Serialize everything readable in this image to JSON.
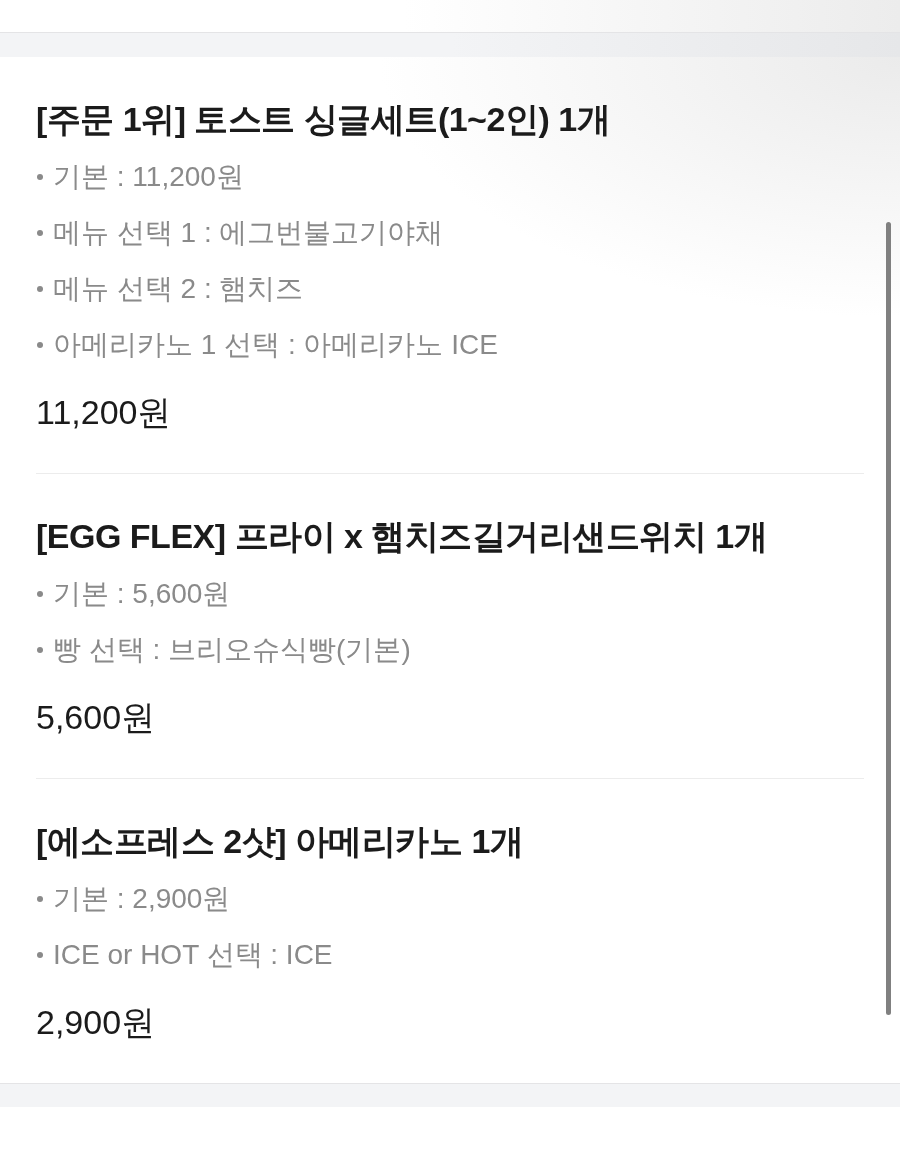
{
  "order_items": [
    {
      "title": "[주문 1위] 토스트 싱글세트(1~2인) 1개",
      "options": [
        "기본 : 11,200원",
        "메뉴 선택 1 : 에그번불고기야채",
        "메뉴 선택 2 : 햄치즈",
        "아메리카노 1 선택 : 아메리카노 ICE"
      ],
      "price": "11,200원"
    },
    {
      "title": "[EGG FLEX] 프라이 x 햄치즈길거리샌드위치 1개",
      "options": [
        "기본 : 5,600원",
        "빵 선택 : 브리오슈식빵(기본)"
      ],
      "price": "5,600원"
    },
    {
      "title": "[에소프레스 2샷] 아메리카노 1개",
      "options": [
        "기본 : 2,900원",
        "ICE or HOT 선택 : ICE"
      ],
      "price": "2,900원"
    }
  ]
}
